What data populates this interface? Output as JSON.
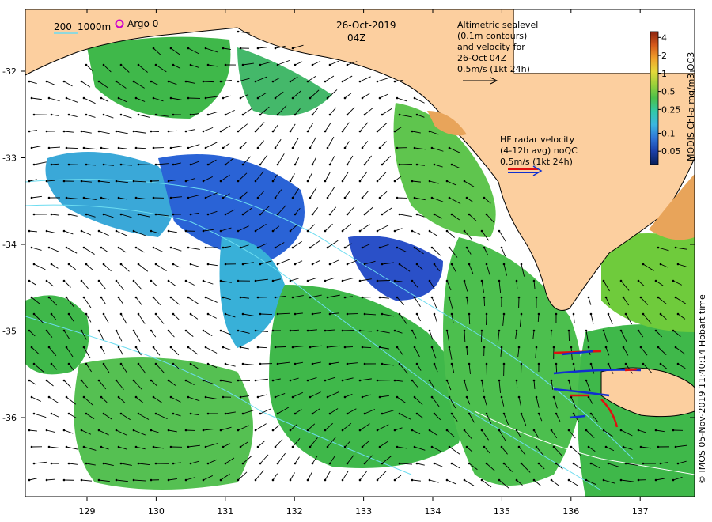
{
  "header": {
    "date": "26-Oct-2019",
    "time": "04Z"
  },
  "legend": {
    "contour_200": "200",
    "contour_1000": "1000m",
    "argo_label": "Argo 0"
  },
  "altimetry_note": {
    "lines": [
      "Altimetric sealevel",
      "(0.1m contours)",
      "and velocity for",
      "26-Oct 04Z",
      "0.5m/s (1kt 24h)"
    ]
  },
  "radar_note": {
    "lines": [
      "HF radar velocity",
      "(4-12h avg) noQC",
      "0.5m/s (1kt 24h)"
    ]
  },
  "colorbar": {
    "title": "MODIS Chl-a mg/m3 OC3",
    "ticks": [
      "4",
      "2",
      "1",
      "0.5",
      "0.25",
      "0.1",
      "0.05"
    ],
    "tick_values": [
      4,
      2,
      1,
      0.5,
      0.25,
      0.1,
      0.05
    ],
    "scale": "log",
    "colors": [
      "#08205a",
      "#1b3fa8",
      "#2f76d8",
      "#3cb6e0",
      "#32c8a8",
      "#4cc04a",
      "#9ad13a",
      "#e6d83a",
      "#f0a02a",
      "#d4581a",
      "#8a2410"
    ]
  },
  "credit": "© IMOS 05-Nov-2019 11:40:14 Hobart time",
  "axes": {
    "x_ticks": [
      "129",
      "130",
      "131",
      "132",
      "133",
      "134",
      "135",
      "136",
      "137"
    ],
    "x_values": [
      129,
      130,
      131,
      132,
      133,
      134,
      135,
      136,
      137
    ],
    "y_ticks": [
      "-32",
      "-33",
      "-34",
      "-35",
      "-36"
    ],
    "y_values": [
      -32,
      -33,
      -34,
      -35,
      -36
    ]
  },
  "colors": {
    "land": "#fccf9f",
    "chl_low": "#2a5fd0",
    "chl_mid": "#38b0d8",
    "chl_high": "#3fb84a",
    "contour": "#6cdcf0",
    "radar_red": "#e01010",
    "radar_blue": "#1030d0",
    "argo": "#cc00cc"
  }
}
